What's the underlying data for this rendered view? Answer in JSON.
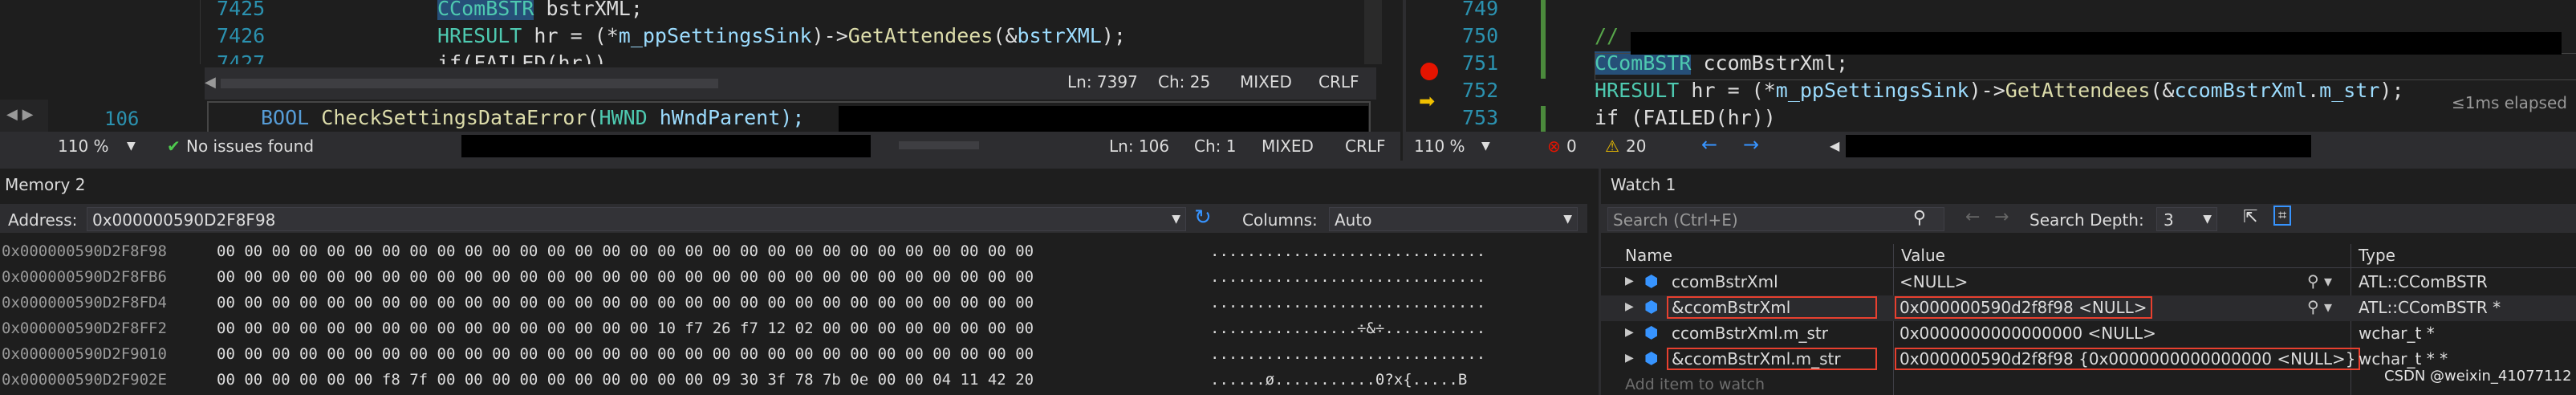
{
  "editor_left": {
    "lines": [
      {
        "num": "7425",
        "tokens": [
          {
            "t": "CComBSTR",
            "c": "ty",
            "hl": true
          },
          {
            "t": " bstrXML;",
            "c": ""
          }
        ]
      },
      {
        "num": "7426",
        "tokens": [
          {
            "t": "HRESULT",
            "c": "ty"
          },
          {
            "t": " hr = (*",
            "c": ""
          },
          {
            "t": "m_ppSettingsSink",
            "c": "pm"
          },
          {
            "t": ")->",
            "c": ""
          },
          {
            "t": "GetAttendees",
            "c": "fn"
          },
          {
            "t": "(&",
            "c": ""
          },
          {
            "t": "bstrXML",
            "c": "pm"
          },
          {
            "t": ");",
            "c": ""
          }
        ]
      },
      {
        "num": "7427",
        "tokens": [
          {
            "t": "if(FAILED(hr))",
            "c": ""
          }
        ]
      }
    ],
    "status": {
      "ln": "Ln: 7397",
      "ch": "Ch: 25",
      "mode": "MIXED",
      "eol": "CRLF"
    },
    "lower_line_num": "106",
    "lower_code": [
      {
        "t": "BOOL",
        "c": "kw"
      },
      {
        "t": " ",
        "c": ""
      },
      {
        "t": "CheckSettingsDataError",
        "c": "fn"
      },
      {
        "t": "(",
        "c": ""
      },
      {
        "t": "HWND",
        "c": "ty"
      },
      {
        "t": " hWndParent);",
        "c": "pm"
      }
    ],
    "bottom_status": {
      "zoom": "110 %",
      "issues": "No issues found",
      "ln": "Ln: 106",
      "ch": "Ch: 1",
      "mode": "MIXED",
      "eol": "CRLF"
    }
  },
  "editor_right": {
    "lines": [
      {
        "num": "749",
        "code": []
      },
      {
        "num": "750",
        "code": [
          {
            "t": "//",
            "c": "cm"
          }
        ]
      },
      {
        "num": "751",
        "code": [
          {
            "t": "CComBSTR",
            "c": "ty",
            "hl": true
          },
          {
            "t": " ccomBstrXml;",
            "c": ""
          }
        ]
      },
      {
        "num": "752",
        "code": [
          {
            "t": "HRESULT",
            "c": "ty"
          },
          {
            "t": " hr = (*",
            "c": ""
          },
          {
            "t": "m_ppSettingsSink",
            "c": "pm"
          },
          {
            "t": ")->",
            "c": ""
          },
          {
            "t": "GetAttendees",
            "c": "fn"
          },
          {
            "t": "(&",
            "c": ""
          },
          {
            "t": "ccomBstrXml",
            "c": "pm"
          },
          {
            "t": ".",
            "c": ""
          },
          {
            "t": "m_str",
            "c": "pm"
          },
          {
            "t": ");",
            "c": ""
          }
        ]
      },
      {
        "num": "753",
        "code": [
          {
            "t": "if (FAILED(hr))",
            "c": ""
          }
        ]
      }
    ],
    "elapsed": "≤1ms elapsed",
    "status": {
      "zoom": "110 %",
      "errors": "0",
      "warnings": "20"
    }
  },
  "memory": {
    "title": "Memory 2",
    "address_label": "Address:",
    "address_value": "0x000000590D2F8F98",
    "columns_label": "Columns:",
    "columns_value": "Auto",
    "rows": [
      {
        "addr": "0x000000590D2F8F98",
        "hex": "00 00 00 00 00 00 00 00 00 00 00 00 00 00 00 00 00 00 00 00 00 00 00 00 00 00 00 00 00 00",
        "ascii": ".............................."
      },
      {
        "addr": "0x000000590D2F8FB6",
        "hex": "00 00 00 00 00 00 00 00 00 00 00 00 00 00 00 00 00 00 00 00 00 00 00 00 00 00 00 00 00 00",
        "ascii": ".............................."
      },
      {
        "addr": "0x000000590D2F8FD4",
        "hex": "00 00 00 00 00 00 00 00 00 00 00 00 00 00 00 00 00 00 00 00 00 00 00 00 00 00 00 00 00 00",
        "ascii": ".............................."
      },
      {
        "addr": "0x000000590D2F8FF2",
        "hex": "00 00 00 00 00 00 00 00 00 00 00 00 00 00 00 00 10 f7 26 f7 12 02 00 00 00 00 00 00 00 00",
        "ascii": "................÷&÷..........."
      },
      {
        "addr": "0x000000590D2F9010",
        "hex": "00 00 00 00 00 00 00 00 00 00 00 00 00 00 00 00 00 00 00 00 00 00 00 00 00 00 00 00 00 00",
        "ascii": ".............................."
      },
      {
        "addr": "0x000000590D2F902E",
        "hex": "00 00 00 00 00 00 f8 7f 00 00 00 00 00 00 00 00 00 00 09 30 3f 78 7b 0e 00 00 04 11 42 20",
        "ascii": "......ø...........0?x{.....B "
      }
    ]
  },
  "watch": {
    "title": "Watch 1",
    "search_placeholder": "Search (Ctrl+E)",
    "depth_label": "Search Depth:",
    "depth_value": "3",
    "headers": {
      "name": "Name",
      "value": "Value",
      "type": "Type"
    },
    "rows": [
      {
        "name": "ccomBstrXml",
        "value": "<NULL>",
        "type": "ATL::CComBSTR",
        "boxed": false,
        "selected": false,
        "lens": true
      },
      {
        "name": "&ccomBstrXml",
        "value": "0x000000590d2f8f98 <NULL>",
        "type": "ATL::CComBSTR *",
        "boxed": true,
        "selected": true,
        "lens": true
      },
      {
        "name": "ccomBstrXml.m_str",
        "value": "0x0000000000000000 <NULL>",
        "type": "wchar_t *",
        "boxed": false,
        "selected": false,
        "lens": false
      },
      {
        "name": "&ccomBstrXml.m_str",
        "value": "0x000000590d2f8f98 {0x0000000000000000 <NULL>}",
        "type": "wchar_t * *",
        "boxed": true,
        "selected": false,
        "lens": false
      }
    ],
    "add_item": "Add item to watch"
  },
  "watermark": "CSDN @weixin_41077112"
}
